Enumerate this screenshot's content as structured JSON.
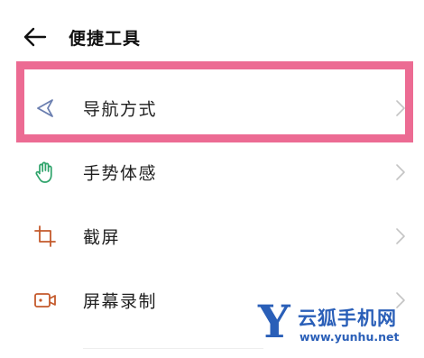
{
  "header": {
    "title": "便捷工具",
    "back_icon": "arrow-left-icon"
  },
  "items": [
    {
      "label": "导航方式",
      "icon": "navigation-triangle-icon",
      "icon_color": "#6b7fb0"
    },
    {
      "label": "手势体感",
      "icon": "hand-gesture-icon",
      "icon_color": "#2ea36a"
    },
    {
      "label": "截屏",
      "icon": "crop-screenshot-icon",
      "icon_color": "#c45a2c"
    },
    {
      "label": "屏幕录制",
      "icon": "screen-record-icon",
      "icon_color": "#c45a2c"
    }
  ],
  "highlight_color": "#ec6b93",
  "watermark": {
    "letter": "Y",
    "name": "云狐手机网",
    "url": "www.yunhu.net"
  }
}
